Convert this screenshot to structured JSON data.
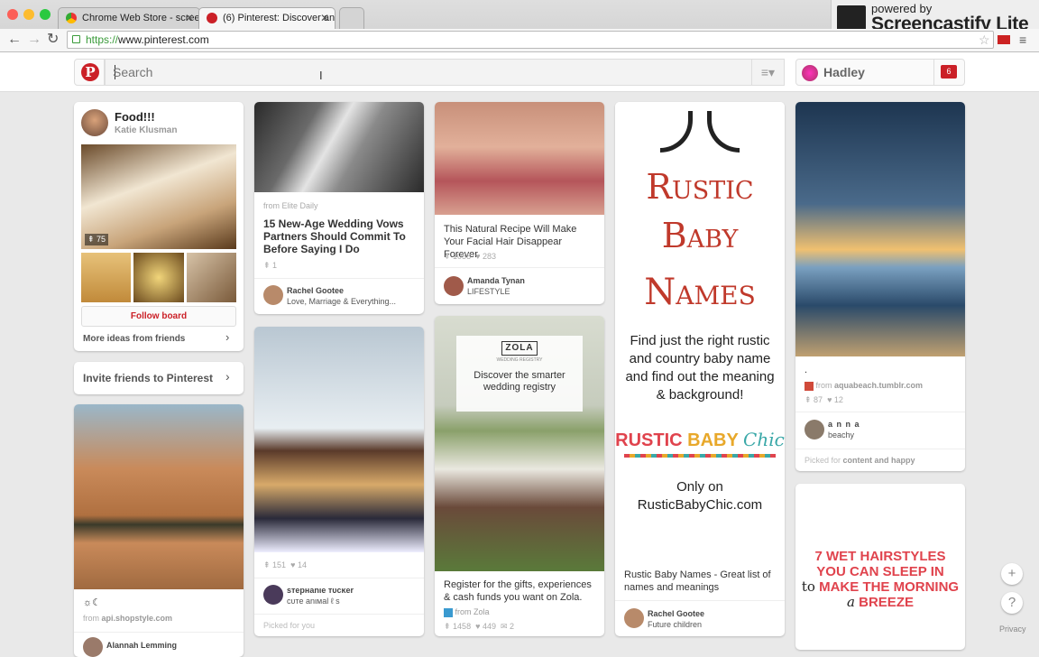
{
  "browser": {
    "tabs": [
      {
        "label": "Chrome Web Store - scree",
        "close": "✕"
      },
      {
        "label": "(6) Pinterest: Discover and",
        "close": "✕"
      }
    ],
    "url_scheme": "https://",
    "url_host": "www.pinterest.com",
    "profile": "Hadley",
    "screencastify": {
      "line1": "powered by",
      "line2": "Screencastify Lite"
    }
  },
  "pinterest": {
    "logo": "P",
    "search_placeholder": "Search",
    "user_name": "Hadley",
    "notifications": "6"
  },
  "board": {
    "title": "Food!!!",
    "owner": "Katie Klusman",
    "pin_count": "75",
    "follow_label": "Follow board",
    "more_ideas": "More ideas from friends"
  },
  "invite": "Invite friends to Pinterest",
  "pins": {
    "bikini": {
      "desc": "☼☾",
      "source_prefix": "from",
      "source": "api.shopstyle.com",
      "user": "Alannah Lemming"
    },
    "wedding": {
      "source": "from Elite Daily",
      "desc": "15 New-Age Wedding Vows Partners Should Commit To Before Saying I Do",
      "repins": "1",
      "user": "Rachel Gootee",
      "board": "Love, Marriage & Everything..."
    },
    "dog": {
      "repins": "151",
      "likes": "14",
      "user": "sтepнanιe тυcĸer",
      "board": "cυтe anιмal ℓ ѕ",
      "picked": "Picked for you"
    },
    "lip": {
      "desc": "This Natural Recipe Will Make Your Facial Hair Disappear Forever",
      "repins": "1058",
      "likes": "283",
      "user": "Amanda Tynan",
      "board": "LIFESTYLE"
    },
    "zola": {
      "brand": "ZOLA",
      "brand_sub": "WEDDING REGISTRY",
      "ad": "Discover the smarter wedding registry",
      "desc": "Register for the gifts, experiences & cash funds you want on Zola.",
      "source": "from Zola",
      "repins": "1458",
      "likes": "449",
      "comments": "2"
    },
    "rustic": {
      "title1": "Rustic",
      "title2": "Baby",
      "title3": "Names",
      "body": "Find just the right rustic and country baby name and find out the meaning & background!",
      "brand1": "RUSTIC",
      "brand2": "BABY",
      "brand3": "Chic",
      "only": "Only on",
      "site": "RusticBabyChic.com",
      "desc": "Rustic Baby Names - Great list of names and meanings",
      "user": "Rachel Gootee",
      "board": "Future children"
    },
    "beach": {
      "desc": ".",
      "source_prefix": "from",
      "source": "aquabeach.tumblr.com",
      "repins": "87",
      "likes": "12",
      "user": "a n n a",
      "board": "beachy",
      "picked_prefix": "Picked for",
      "picked_topic": "content and happy"
    },
    "hair": {
      "line1": "7 WET HAIRSTYLES",
      "line2": "YOU CAN SLEEP IN",
      "line3a": "to",
      "line3b": "MAKE THE MORNING",
      "line4a": "a",
      "line4b": "BREEZE"
    }
  },
  "fab": {
    "plus": "+",
    "help": "?",
    "privacy": "Privacy"
  },
  "colors": {
    "brand_red": "#cb2027",
    "rustic_red": "#c0392b",
    "hair_red": "#e0434d"
  }
}
